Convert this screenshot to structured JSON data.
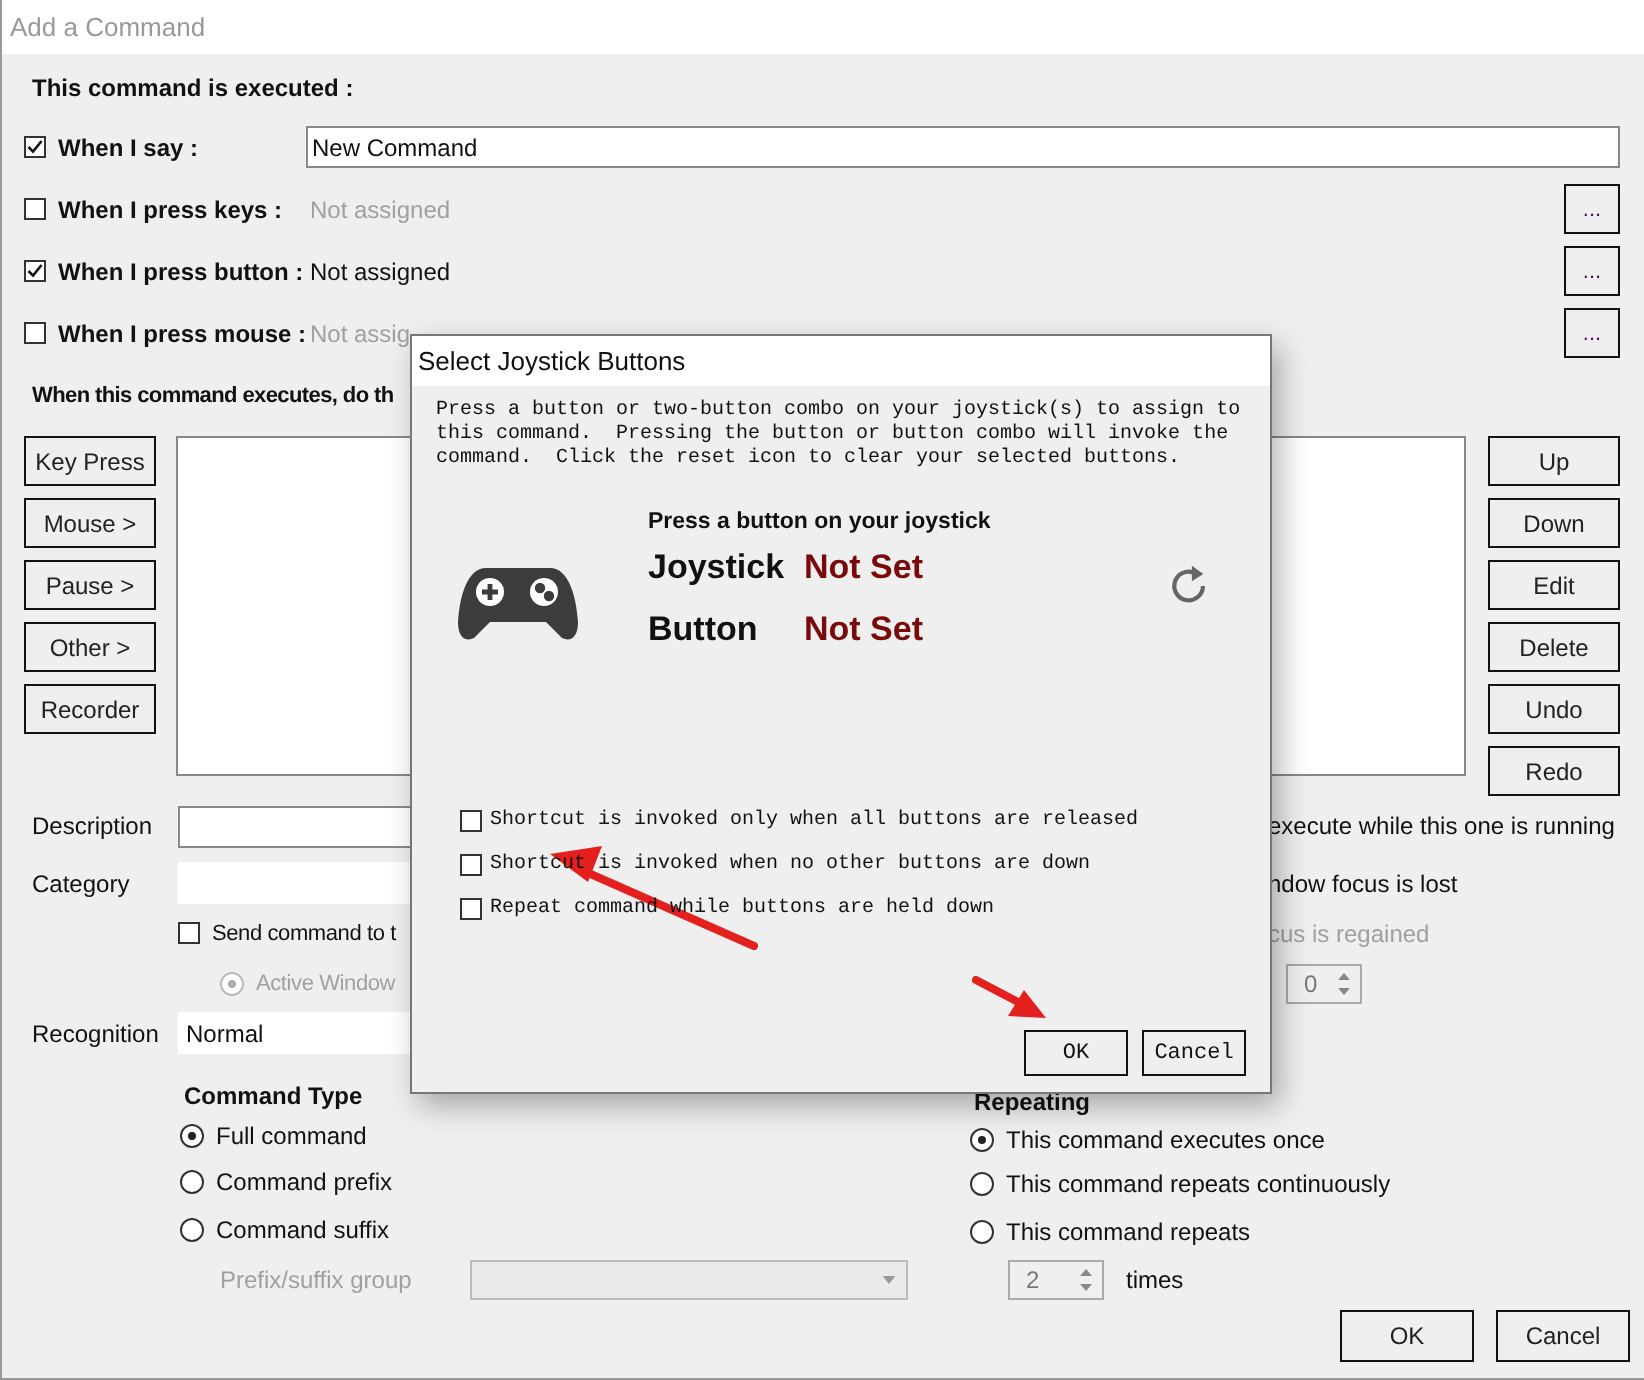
{
  "window": {
    "title": "Add a Command"
  },
  "executed_label": "This command is executed :",
  "triggers": [
    {
      "label": "When I say :",
      "checked": true,
      "kind": "text",
      "value": "New Command"
    },
    {
      "label": "When I press keys :",
      "checked": false,
      "kind": "assign",
      "value": "Not assigned",
      "disabled": true,
      "button": "..."
    },
    {
      "label": "When I press button :",
      "checked": true,
      "kind": "assign",
      "value": "Not assigned",
      "disabled": false,
      "button": "..."
    },
    {
      "label": "When I press mouse :",
      "checked": false,
      "kind": "assign",
      "value": "Not assig",
      "disabled": true,
      "button": "..."
    }
  ],
  "actions_label": "When this command executes, do th",
  "action_buttons": [
    "Key Press",
    "Mouse >",
    "Pause >",
    "Other >",
    "Recorder"
  ],
  "edit_buttons": [
    "Up",
    "Down",
    "Edit",
    "Delete",
    "Undo",
    "Redo"
  ],
  "description": {
    "label": "Description",
    "option": {
      "text": "execute while this one is running",
      "disabled": false
    }
  },
  "category": {
    "label": "Category",
    "option": {
      "text": "ndow focus is lost",
      "disabled": false
    }
  },
  "send_command": {
    "label": "Send command to t",
    "checked": false,
    "option": {
      "text": "cus is regained",
      "disabled": true
    }
  },
  "active_window": {
    "label": "Active Window",
    "selected": true,
    "disabled": true,
    "spin_value": "0"
  },
  "recognition": {
    "label": "Recognition",
    "value": "Normal"
  },
  "command_type": {
    "title": "Command Type",
    "options": [
      {
        "label": "Full command",
        "selected": true
      },
      {
        "label": "Command prefix",
        "selected": false
      },
      {
        "label": "Command suffix",
        "selected": false
      }
    ],
    "group_label": "Prefix/suffix group",
    "group_disabled": true
  },
  "repeating": {
    "title": "Repeating",
    "options": [
      {
        "label": "This command executes once",
        "selected": true
      },
      {
        "label": "This command repeats continuously",
        "selected": false
      },
      {
        "label": "This command repeats",
        "selected": false
      }
    ],
    "count": "2",
    "unit": "times"
  },
  "footer_buttons": [
    "OK",
    "Cancel"
  ],
  "dialog": {
    "title": "Select Joystick Buttons",
    "description": "Press a button or two-button combo on your joystick(s) to assign to this command.  Pressing the button or button combo will invoke the command.  Click the reset icon to clear your selected buttons.",
    "prompt": "Press a button on your joystick",
    "fields": [
      {
        "label": "Joystick",
        "value": "Not Set"
      },
      {
        "label": "Button",
        "value": "Not Set"
      }
    ],
    "options": [
      {
        "label": "Shortcut is invoked only when all buttons are released",
        "checked": false
      },
      {
        "label": "Shortcut is invoked when no other buttons are down",
        "checked": false
      },
      {
        "label": "Repeat command while buttons are held down",
        "checked": false
      }
    ],
    "buttons": [
      "OK",
      "Cancel"
    ]
  }
}
